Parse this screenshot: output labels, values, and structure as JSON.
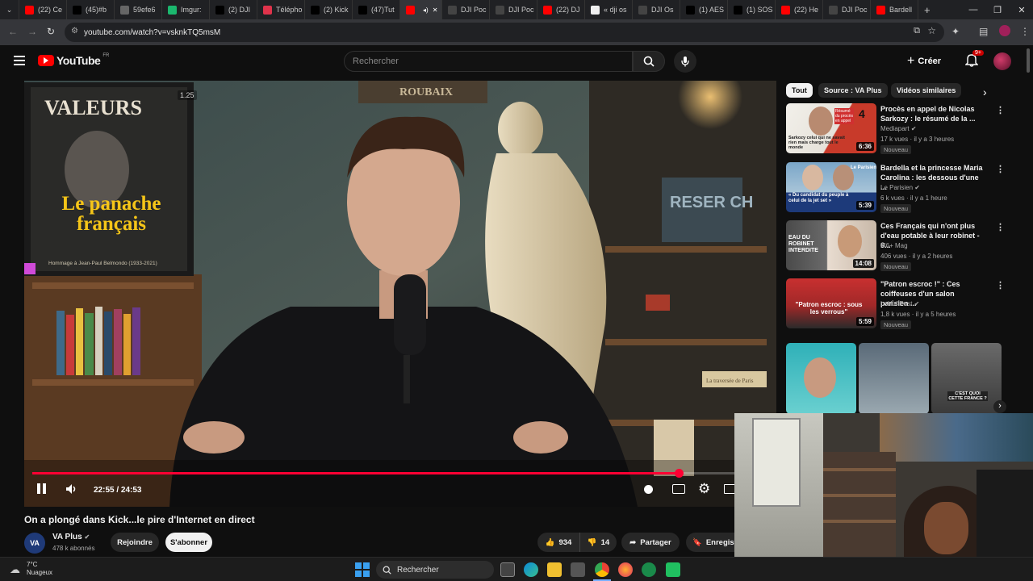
{
  "browser": {
    "tabs": [
      {
        "label": "(22) Ce",
        "color": "#ff0000"
      },
      {
        "label": "(45)#b",
        "color": "#000000"
      },
      {
        "label": "59efe6",
        "color": "#666666"
      },
      {
        "label": "Imgur:",
        "color": "#1bb76e"
      },
      {
        "label": "(2) DJI",
        "color": "#000000"
      },
      {
        "label": "Télépho",
        "color": "#e0334b"
      },
      {
        "label": "(2) Kick",
        "color": "#000000"
      },
      {
        "label": "(47)Tut",
        "color": "#000000"
      },
      {
        "label": "",
        "color": "#ff0000"
      },
      {
        "label": "DJI Poc",
        "color": "#444444"
      },
      {
        "label": "DJI Poc",
        "color": "#444444"
      },
      {
        "label": "(22) DJ",
        "color": "#ff0000"
      },
      {
        "label": "« dji os",
        "color": "#f0f0f0"
      },
      {
        "label": "DJI Os",
        "color": "#444444"
      },
      {
        "label": "(1) AES",
        "color": "#000000"
      },
      {
        "label": "(1) SOS",
        "color": "#000000"
      },
      {
        "label": "(22) He",
        "color": "#ff0000"
      },
      {
        "label": "DJI Poc",
        "color": "#444444"
      },
      {
        "label": "Bardell",
        "color": "#ff0000"
      }
    ],
    "url": "youtube.com/watch?v=vsknkTQ5msM"
  },
  "youtube": {
    "logo_text": "YouTube",
    "logo_region": "FR",
    "search_placeholder": "Rechercher",
    "create_label": "Créer",
    "notif_count": "9+"
  },
  "player": {
    "speed_badge": "1.25",
    "time": "22:55 / 24:53",
    "progress": 0.921,
    "overlay_texts": {
      "magazine_top": "VALEURS",
      "magazine_title": "Le panache français",
      "magazine_sub": "Hommage à Jean-Paul Belmondo (1933-2021)",
      "banner": "ROUBAIX",
      "sign": "RESER CH",
      "book": "La traversée de Paris"
    }
  },
  "video": {
    "title": "On a plongé dans Kick...le pire d'Internet en direct",
    "channel": "VA Plus",
    "channel_avatar": "VA",
    "subscribers": "478 k abonnés",
    "join_label": "Rejoindre",
    "subscribe_label": "S'abonner",
    "likes": "934",
    "dislikes": "14",
    "share_label": "Partager",
    "save_label": "Enregist"
  },
  "chips": [
    "Tout",
    "Source : VA Plus",
    "Vidéos similaires"
  ],
  "recommendations": [
    {
      "title": "Procès en appel de Nicolas Sarkozy : le résumé de la ...",
      "channel": "Mediapart",
      "meta": "17 k vues · il y a 3 heures",
      "badge": "Nouveau",
      "duration": "6:36",
      "thumb_text": "Sarkozy celui qui ne savait rien mais charge tout le monde",
      "thumb_num": "4",
      "thumb_tag": "Résumé du procès en appel"
    },
    {
      "title": "Bardella et la princesse Maria Carolina : les dessous d'une ...",
      "channel": "Le Parisien",
      "meta": "6 k vues · il y a 1 heure",
      "badge": "Nouveau",
      "duration": "5:39",
      "thumb_text": "« Du candidat du peuple à celui de la jet set »",
      "thumb_tag": "Le Parisien"
    },
    {
      "title": "Ces Français qui n'ont plus d'eau potable à leur robinet - 6...",
      "channel": "M6+ Mag",
      "meta": "406 vues · il y a 2 heures",
      "badge": "Nouveau",
      "duration": "14:08",
      "thumb_text": "EAU DU ROBINET INTERDITE"
    },
    {
      "title": "\"Patron escroc !\" : Ces coiffeuses d'un salon parisien ...",
      "channel": "LeHuffPost",
      "meta": "1,8 k vues · il y a 5 heures",
      "badge": "Nouveau",
      "duration": "5:59",
      "thumb_text": "\"Patron escroc : sous les verrous\""
    }
  ],
  "shorts_texts": [
    "C'EST QUOI CETTE FRANCE ?"
  ],
  "taskbar": {
    "weather_temp": "7°C",
    "weather_desc": "Nuageux",
    "search_label": "Rechercher"
  },
  "colors": {
    "youtube_red": "#ff0000",
    "progress_red": "#ff0033",
    "background": "#0f0f0f"
  }
}
